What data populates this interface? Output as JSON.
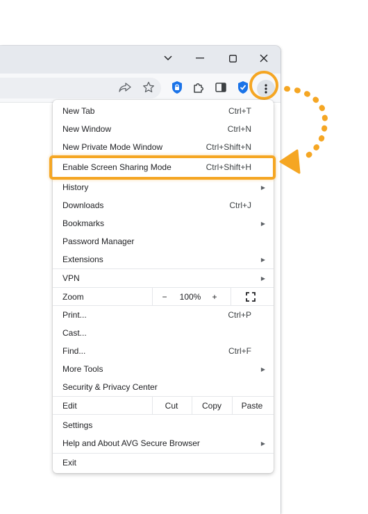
{
  "window": {
    "controls": [
      "tab-search-icon",
      "minimize-icon",
      "maximize-icon",
      "close-icon"
    ]
  },
  "toolbar": {
    "icons": [
      "share-icon",
      "bookmark-star-icon",
      "privacy-shield-icon",
      "extensions-icon",
      "side-panel-icon",
      "security-badge-icon",
      "menu-kebab-icon"
    ]
  },
  "menu": {
    "new_tab": {
      "label": "New Tab",
      "shortcut": "Ctrl+T"
    },
    "new_window": {
      "label": "New Window",
      "shortcut": "Ctrl+N"
    },
    "new_private": {
      "label": "New Private Mode Window",
      "shortcut": "Ctrl+Shift+N"
    },
    "screen_sharing": {
      "label": "Enable Screen Sharing Mode",
      "shortcut": "Ctrl+Shift+H"
    },
    "history": {
      "label": "History"
    },
    "downloads": {
      "label": "Downloads",
      "shortcut": "Ctrl+J"
    },
    "bookmarks": {
      "label": "Bookmarks"
    },
    "password_manager": {
      "label": "Password Manager"
    },
    "extensions": {
      "label": "Extensions"
    },
    "vpn": {
      "label": "VPN"
    },
    "zoom": {
      "label": "Zoom",
      "minus": "−",
      "value": "100%",
      "plus": "+"
    },
    "print": {
      "label": "Print...",
      "shortcut": "Ctrl+P"
    },
    "cast": {
      "label": "Cast..."
    },
    "find": {
      "label": "Find...",
      "shortcut": "Ctrl+F"
    },
    "more_tools": {
      "label": "More Tools"
    },
    "security_center": {
      "label": "Security & Privacy Center"
    },
    "edit": {
      "label": "Edit",
      "cut": "Cut",
      "copy": "Copy",
      "paste": "Paste"
    },
    "settings": {
      "label": "Settings"
    },
    "help": {
      "label": "Help and About AVG Secure Browser"
    },
    "exit": {
      "label": "Exit"
    }
  },
  "colors": {
    "highlight": "#f5a623",
    "accent": "#1a73e8"
  }
}
